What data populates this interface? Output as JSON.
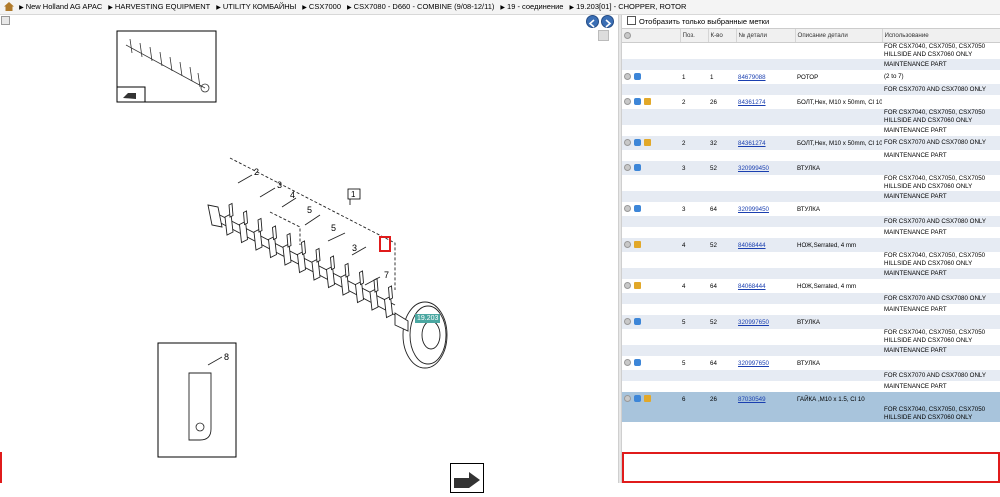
{
  "breadcrumb": [
    "New Holland AG APAC",
    "HARVESTING EQUIPMENT",
    "UTILITY КОМБАЙНЫ",
    "CSX7000",
    "CSX7080 - D660 - COMBINE (9/08-12/11)",
    "19 - соединение",
    "19.203[01] - CHOPPER, ROTOR"
  ],
  "drawing": {
    "callouts": [
      "1",
      "2",
      "3",
      "4",
      "5",
      "5",
      "3",
      "7",
      "8"
    ],
    "ref_tag": "19.203"
  },
  "filter": {
    "label": "Отобразить только выбранные метки"
  },
  "table": {
    "columns": [
      "",
      "Поз.",
      "К-во",
      "№ детали",
      "Описание детали",
      "Использование"
    ],
    "rows": [
      {
        "kind": "note",
        "use": "FOR CSX7040, CSX7050, CSX7050 HILLSIDE AND CSX7060 ONLY"
      },
      {
        "kind": "note",
        "use": "MAINTENANCE PART"
      },
      {
        "kind": "part",
        "icons": [
          "gray",
          "blue"
        ],
        "pos": "1",
        "qty": "1",
        "part": "84679088",
        "desc": "РОТОР",
        "use": "(2 to 7)"
      },
      {
        "kind": "note",
        "use": "FOR CSX7070 AND CSX7080 ONLY"
      },
      {
        "kind": "part",
        "icons": [
          "gray",
          "blue",
          "gold"
        ],
        "pos": "2",
        "qty": "26",
        "part": "84361274",
        "desc": "БОЛТ,Hex, M10 x 50mm, Cl 10.9",
        "use": ""
      },
      {
        "kind": "note",
        "use": "FOR CSX7040, CSX7050, CSX7050 HILLSIDE AND CSX7060 ONLY"
      },
      {
        "kind": "note",
        "use": "MAINTENANCE PART"
      },
      {
        "kind": "part",
        "icons": [
          "gray",
          "blue",
          "gold"
        ],
        "pos": "2",
        "qty": "32",
        "part": "84361274",
        "desc": "БОЛТ,Hex, M10 x 50mm, Cl 10.9",
        "use": "FOR CSX7070 AND CSX7080 ONLY"
      },
      {
        "kind": "note",
        "use": "MAINTENANCE PART"
      },
      {
        "kind": "part",
        "icons": [
          "gray",
          "blue"
        ],
        "pos": "3",
        "qty": "52",
        "part": "320999450",
        "desc": "ВТУЛКА",
        "use": ""
      },
      {
        "kind": "note",
        "use": "FOR CSX7040, CSX7050, CSX7050 HILLSIDE AND CSX7060 ONLY"
      },
      {
        "kind": "note",
        "use": "MAINTENANCE PART"
      },
      {
        "kind": "part",
        "icons": [
          "gray",
          "blue"
        ],
        "pos": "3",
        "qty": "64",
        "part": "320999450",
        "desc": "ВТУЛКА",
        "use": ""
      },
      {
        "kind": "note",
        "use": "FOR CSX7070 AND CSX7080 ONLY"
      },
      {
        "kind": "note",
        "use": "MAINTENANCE PART"
      },
      {
        "kind": "part",
        "icons": [
          "gray",
          "gold"
        ],
        "pos": "4",
        "qty": "52",
        "part": "84068444",
        "desc": "НОЖ,Serrated, 4 mm",
        "use": ""
      },
      {
        "kind": "note",
        "use": "FOR CSX7040, CSX7050, CSX7050 HILLSIDE AND CSX7060 ONLY"
      },
      {
        "kind": "note",
        "use": "MAINTENANCE PART"
      },
      {
        "kind": "part",
        "icons": [
          "gray",
          "gold"
        ],
        "pos": "4",
        "qty": "64",
        "part": "84068444",
        "desc": "НОЖ,Serrated, 4 mm",
        "use": ""
      },
      {
        "kind": "note",
        "use": "FOR CSX7070 AND CSX7080 ONLY"
      },
      {
        "kind": "note",
        "use": "MAINTENANCE PART"
      },
      {
        "kind": "part",
        "icons": [
          "gray",
          "blue"
        ],
        "pos": "5",
        "qty": "52",
        "part": "320997650",
        "desc": "ВТУЛКА",
        "use": ""
      },
      {
        "kind": "note",
        "use": "FOR CSX7040, CSX7050, CSX7050 HILLSIDE AND CSX7060 ONLY"
      },
      {
        "kind": "note",
        "use": "MAINTENANCE PART"
      },
      {
        "kind": "part",
        "icons": [
          "gray",
          "blue"
        ],
        "pos": "5",
        "qty": "64",
        "part": "320997650",
        "desc": "ВТУЛКА",
        "use": ""
      },
      {
        "kind": "note",
        "use": "FOR CSX7070 AND CSX7080 ONLY"
      },
      {
        "kind": "note",
        "use": "MAINTENANCE PART"
      },
      {
        "kind": "part",
        "icons": [
          "gray",
          "blue",
          "gold"
        ],
        "pos": "6",
        "qty": "26",
        "part": "87030549",
        "desc": "ГАЙКА ,M10 x 1.5, Cl 10",
        "use": "",
        "selected": true
      },
      {
        "kind": "note",
        "use": "FOR CSX7040, CSX7050, CSX7050 HILLSIDE AND CSX7060 ONLY",
        "selected": true
      }
    ]
  }
}
